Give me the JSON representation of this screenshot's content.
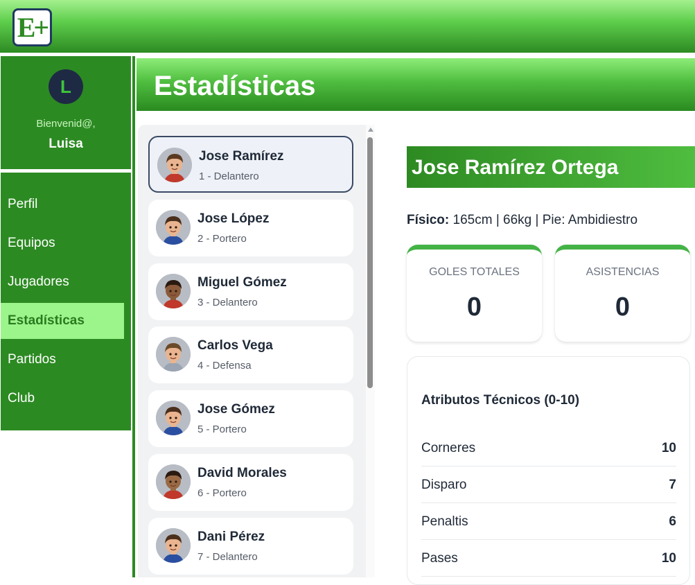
{
  "app": {
    "logo_text": "E+"
  },
  "profile": {
    "initial": "L",
    "welcome": "Bienvenid@,",
    "name": "Luisa"
  },
  "nav": {
    "items": [
      {
        "label": "Perfil"
      },
      {
        "label": "Equipos"
      },
      {
        "label": "Jugadores"
      },
      {
        "label": "Estadísticas",
        "active": true
      },
      {
        "label": "Partidos"
      },
      {
        "label": "Club"
      }
    ]
  },
  "page": {
    "title": "Estadísticas"
  },
  "players": [
    {
      "name": "Jose Ramírez",
      "meta": "1 - Delantero",
      "skin": "#e9b48f",
      "hair": "#5a3a22",
      "shirt": "#c0392b",
      "selected": true
    },
    {
      "name": "Jose López",
      "meta": "2 - Portero",
      "skin": "#e9b48f",
      "hair": "#4a2f1b",
      "shirt": "#2b4fa0"
    },
    {
      "name": "Miguel Gómez",
      "meta": "3 - Delantero",
      "skin": "#8a5a3a",
      "hair": "#2a1a10",
      "shirt": "#c0392b"
    },
    {
      "name": "Carlos Vega",
      "meta": "4 - Defensa",
      "skin": "#e9b48f",
      "hair": "#6b4a2b",
      "shirt": "#9aa4b2"
    },
    {
      "name": "Jose Gómez",
      "meta": "5 - Portero",
      "skin": "#e9b48f",
      "hair": "#4a2f1b",
      "shirt": "#2b4fa0"
    },
    {
      "name": "David Morales",
      "meta": "6 - Portero",
      "skin": "#9a6a45",
      "hair": "#2a1a10",
      "shirt": "#c0392b"
    },
    {
      "name": "Dani Pérez",
      "meta": "7 - Delantero",
      "skin": "#e9b48f",
      "hair": "#4a2f1b",
      "shirt": "#2b4fa0"
    }
  ],
  "detail": {
    "full_name": "Jose Ramírez Ortega",
    "fisico_label": "Físico:",
    "fisico_value": "165cm | 66kg | Pie: Ambidiestro",
    "stats": [
      {
        "label": "GOLES TOTALES",
        "value": "0"
      },
      {
        "label": "ASISTENCIAS",
        "value": "0"
      }
    ],
    "attributes_title": "Atributos Técnicos (0-10)",
    "attributes": [
      {
        "name": "Corneres",
        "value": "10"
      },
      {
        "name": "Disparo",
        "value": "7"
      },
      {
        "name": "Penaltis",
        "value": "6"
      },
      {
        "name": "Pases",
        "value": "10"
      }
    ]
  },
  "colors": {
    "primary_green": "#2c8a22",
    "active_nav": "#9cf58a",
    "stat_accent": "#44b346"
  }
}
